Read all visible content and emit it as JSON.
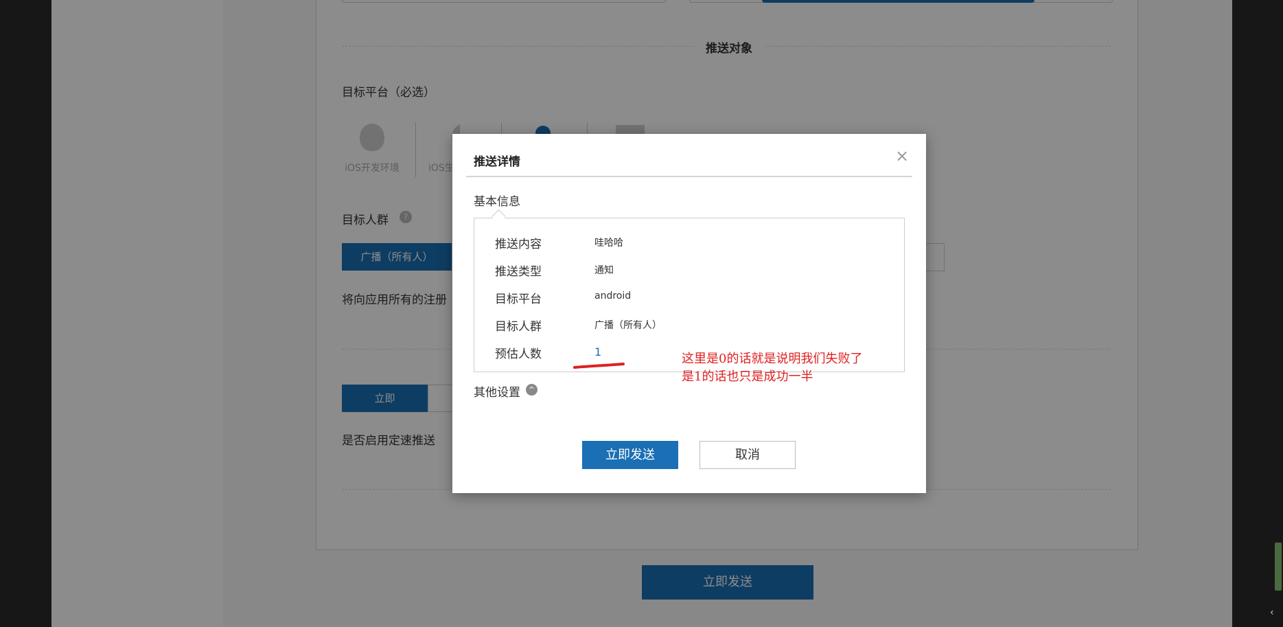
{
  "background": {
    "section_push_target": "推送对象",
    "target_platform_label": "目标平台（必选）",
    "platforms": [
      {
        "icon": "apple-icon",
        "label": "iOS开发环境"
      },
      {
        "icon": "apple-icon",
        "label": "iOS生"
      },
      {
        "icon": "android-icon",
        "label": ""
      },
      {
        "icon": "windows-icon",
        "label": ""
      }
    ],
    "target_audience_label": "目标人群",
    "help_mark": "?",
    "broadcast_button": "广播（所有人）",
    "broadcast_desc": "将向应用所有的注册",
    "send_time_now_button": "立即",
    "rate_limit_label": "是否启用定速推送",
    "bottom_send_button": "立即发送"
  },
  "modal": {
    "title": "推送详情",
    "close_glyph": "×",
    "basic_info_label": "基本信息",
    "rows": [
      {
        "key": "推送内容",
        "value": "哇哈哈"
      },
      {
        "key": "推送类型",
        "value": "通知"
      },
      {
        "key": "目标平台",
        "value": "android"
      },
      {
        "key": "目标人群",
        "value": "广播（所有人）"
      },
      {
        "key": "预估人数",
        "value": "1"
      }
    ],
    "other_settings_label": "其他设置",
    "other_settings_toggle": "^",
    "send_now_button": "立即发送",
    "cancel_button": "取消"
  },
  "annotation": {
    "line1": "这里是0的话就是说明我们失败了",
    "line2": "是1的话也只是成功一半",
    "color": "#e02020"
  },
  "colors": {
    "primary": "#1a6fb5",
    "overlay": "rgba(0,0,0,0.45)"
  }
}
